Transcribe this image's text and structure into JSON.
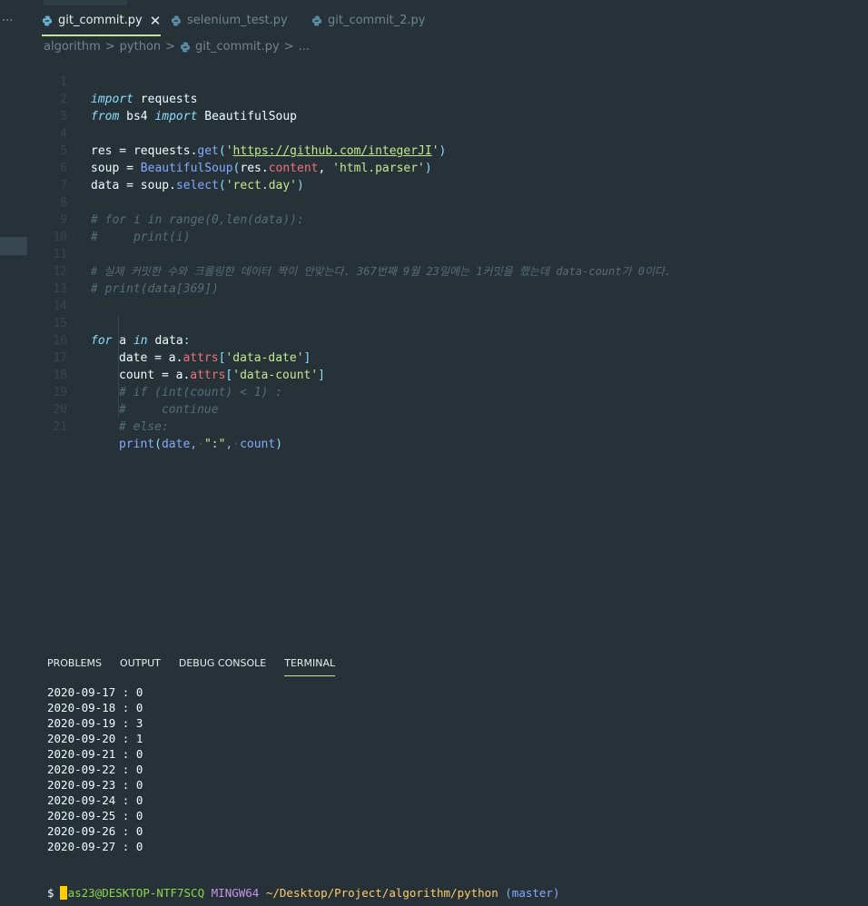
{
  "tabs": [
    {
      "label": "git_commit.py",
      "active": true
    },
    {
      "label": "selenium_test.py",
      "active": false
    },
    {
      "label": "git_commit_2.py",
      "active": false
    }
  ],
  "overflow_menu": "...",
  "breadcrumb": {
    "items": [
      "algorithm",
      "python",
      "git_commit.py",
      "..."
    ],
    "separator": ">"
  },
  "code": {
    "line_numbers": [
      "1",
      "2",
      "3",
      "4",
      "5",
      "6",
      "7",
      "8",
      "9",
      "10",
      "11",
      "12",
      "13",
      "14",
      "15",
      "16",
      "17",
      "18",
      "19",
      "20",
      "21"
    ],
    "l1": {
      "kw": "import",
      "rest": " requests"
    },
    "l2": {
      "kw1": "from",
      "mod": " bs4 ",
      "kw2": "import",
      "rest": " BeautifulSoup"
    },
    "l4": {
      "a": "res",
      "b": " = requests.",
      "fn": "get",
      "p1": "(",
      "q1": "'",
      "url": "https://github.com/integerJI",
      "q2": "'",
      "p2": ")"
    },
    "l5": {
      "a": "soup",
      "b": " = ",
      "fn": "BeautifulSoup",
      "p1": "(",
      "c": "res.",
      "prop": "content",
      "d": ", ",
      "str": "'html.parser'",
      "p2": ")"
    },
    "l6": {
      "a": "data",
      "b": " = soup.",
      "fn": "select",
      "p1": "(",
      "str": "'rect.day'",
      "p2": ")"
    },
    "l8": "# for i in range(0,len(data)):",
    "l9": "#     print(i)",
    "l11": "# 실제 커밋한 수와 크롤링한 데이터 짝이 안맞는다. 367번째 9월 23일에는 1커밋을 했는데 data-count가 0이다.",
    "l12": "# print(data[369])",
    "l15": {
      "kw1": "for",
      "a": " a ",
      "kw2": "in",
      "b": " data",
      "c": ":"
    },
    "l16": {
      "a": "date = a.",
      "prop": "attrs",
      "p1": "[",
      "str": "'data-date'",
      "p2": "]"
    },
    "l17": {
      "a": "count = a.",
      "prop": "attrs",
      "p1": "[",
      "str": "'data-count'",
      "p2": "]"
    },
    "l18": "# if (int(count) < 1) :",
    "l19": "#     continue",
    "l20": "# else:",
    "l21": {
      "fn": "print",
      "p1": "(",
      "a": "date,",
      "ws1": "·",
      "str": "\":\"",
      "b": ",",
      "ws2": "·",
      "c": "count",
      "p2": ")"
    }
  },
  "panel": {
    "tabs": [
      {
        "label": "PROBLEMS",
        "active": false
      },
      {
        "label": "OUTPUT",
        "active": false
      },
      {
        "label": "DEBUG CONSOLE",
        "active": false
      },
      {
        "label": "TERMINAL",
        "active": true
      }
    ]
  },
  "terminal": {
    "lines": [
      "2020-09-17 : 0",
      "2020-09-18 : 0",
      "2020-09-19 : 3",
      "2020-09-20 : 1",
      "2020-09-21 : 0",
      "2020-09-22 : 0",
      "2020-09-23 : 0",
      "2020-09-24 : 0",
      "2020-09-25 : 0",
      "2020-09-26 : 0",
      "2020-09-27 : 0"
    ],
    "prompt": {
      "user_host": "kas23@DESKTOP-NTF7SCQ",
      "system": "MINGW64",
      "path": "~/Desktop/Project/algorithm/python",
      "branch": "(master)"
    },
    "symbol": "$"
  },
  "colors": {
    "background": "#263238",
    "keyword": "#89ddff",
    "function": "#82aaff",
    "string": "#c3e88d",
    "property": "#f07178",
    "comment": "#546e7a",
    "active_tab_underline": "#c3e88d",
    "cursor": "#ffcc00"
  }
}
